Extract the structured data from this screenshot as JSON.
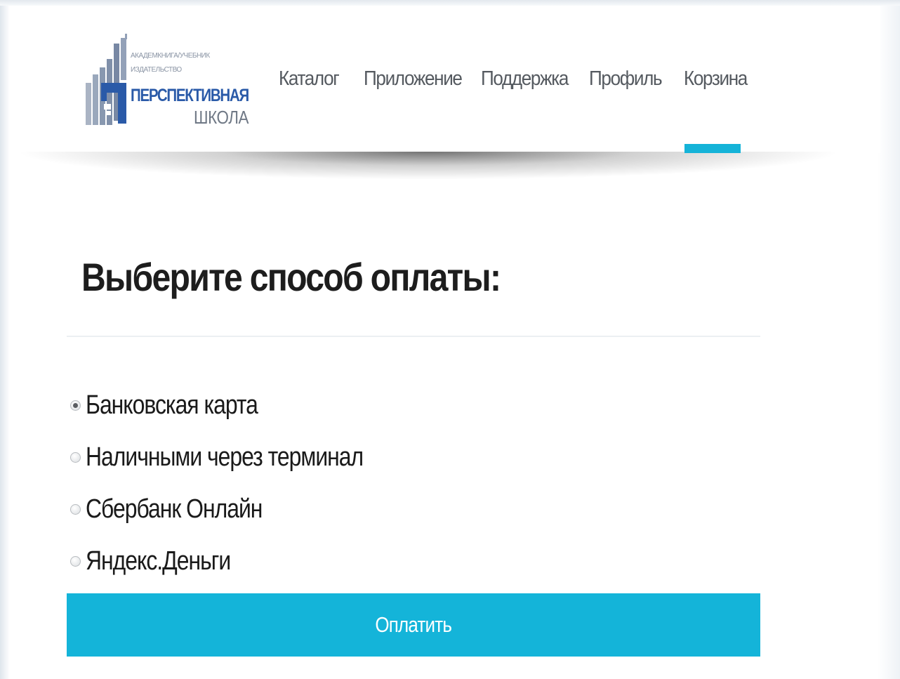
{
  "header": {
    "logo": {
      "line1": "АКАДЕМКНИГА/УЧЕБНИК",
      "line2": "ИЗДАТЕЛЬСТВО",
      "line3": "ПЕРСПЕКТИВНАЯ",
      "line4": "ШКОЛА"
    },
    "nav": [
      {
        "label": "Каталог"
      },
      {
        "label": "Приложение"
      },
      {
        "label": "Поддержка"
      },
      {
        "label": "Профиль"
      },
      {
        "label": "Корзина",
        "active": true
      }
    ]
  },
  "main": {
    "title": "Выберите способ оплаты:",
    "payment_options": [
      {
        "label": "Банковская карта",
        "selected": true
      },
      {
        "label": "Наличными через терминал",
        "selected": false
      },
      {
        "label": "Сбербанк Онлайн",
        "selected": false
      },
      {
        "label": "Яндекс.Деньги",
        "selected": false
      }
    ],
    "pay_button": "Оплатить"
  },
  "colors": {
    "accent": "#15b3d8",
    "logo_blue": "#2a5aa8",
    "text": "#1d1d1d",
    "nav_text": "#555a60"
  }
}
